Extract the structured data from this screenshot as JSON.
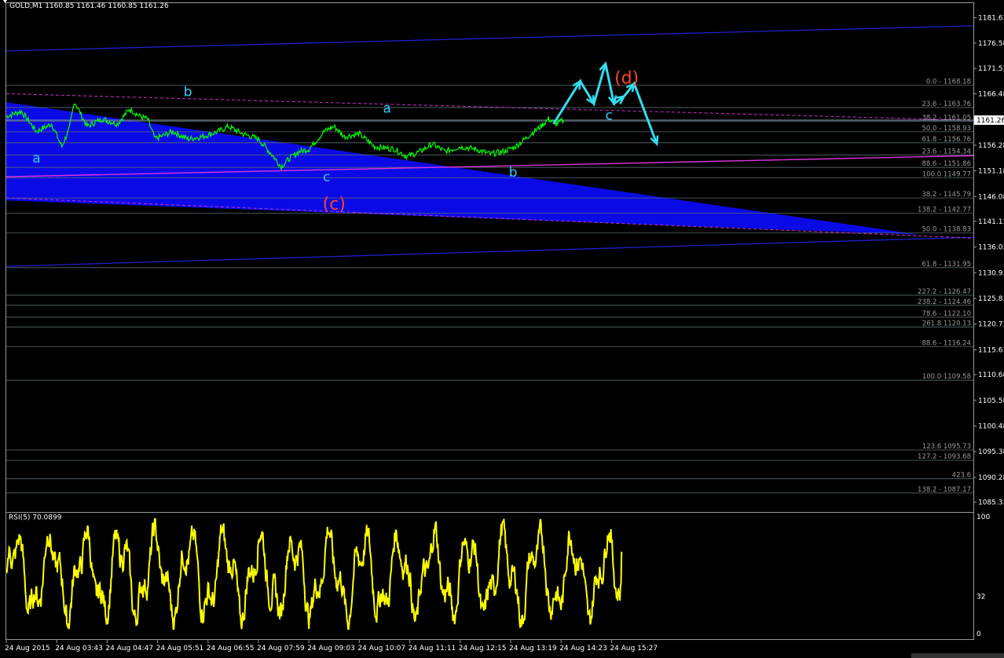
{
  "title": "GOLD,M1  1160.85 1161.46 1160.85 1161.26",
  "colors": {
    "background": "#000000",
    "price_line": "#00ff00",
    "triangle_fill": "#0a0ae6",
    "channel": "#2020d0",
    "dashed_magenta": "#cc33cc",
    "wave_label": "#33ccff",
    "wave_label_big": "#ff4422",
    "rsi_line": "#ffff00",
    "current_price_bg": "#ffffff"
  },
  "chart_data": {
    "type": "line",
    "symbol": "GOLD",
    "timeframe": "M1",
    "ohlc_header": {
      "open": 1160.85,
      "high": 1161.46,
      "low": 1160.85,
      "close": 1161.26
    },
    "current_price": 1161.26,
    "ylim": [
      1083.4,
      1184.5
    ],
    "y_ticks": [
      "1181.63",
      "1176.58",
      "1171.53",
      "1166.48",
      "1161.26",
      "1156.28",
      "1151.18",
      "1146.08",
      "1141.13",
      "1136.03",
      "1130.93",
      "1125.83",
      "1120.73",
      "1115.63",
      "1110.68",
      "1105.58",
      "1100.48",
      "1095.38",
      "1090.28",
      "1085.33"
    ],
    "x_ticks": [
      "24 Aug 2015",
      "24 Aug 03:43",
      "24 Aug 04:47",
      "24 Aug 05:51",
      "24 Aug 06:55",
      "24 Aug 07:59",
      "24 Aug 09:03",
      "24 Aug 10:07",
      "24 Aug 11:11",
      "24 Aug 12:15",
      "24 Aug 13:19",
      "24 Aug 14:23",
      "24 Aug 15:27"
    ],
    "price_anchors": [
      [
        0,
        1162.0
      ],
      [
        0.3,
        1163.0
      ],
      [
        0.6,
        1159.0
      ],
      [
        0.9,
        1160.5
      ],
      [
        1.1,
        1156.0
      ],
      [
        1.25,
        1159.5
      ],
      [
        1.35,
        1165.0
      ],
      [
        1.6,
        1160.0
      ],
      [
        1.9,
        1161.5
      ],
      [
        2.2,
        1160.5
      ],
      [
        2.45,
        1163.5
      ],
      [
        2.65,
        1162.0
      ],
      [
        2.8,
        1161.5
      ],
      [
        2.95,
        1157.5
      ],
      [
        3.3,
        1159.0
      ],
      [
        3.6,
        1157.5
      ],
      [
        3.9,
        1158.0
      ],
      [
        4.2,
        1159.0
      ],
      [
        4.4,
        1160.0
      ],
      [
        4.7,
        1158.5
      ],
      [
        5.0,
        1157.5
      ],
      [
        5.3,
        1154.0
      ],
      [
        5.45,
        1152.0
      ],
      [
        5.6,
        1153.5
      ],
      [
        5.8,
        1155.0
      ],
      [
        6.0,
        1155.5
      ],
      [
        6.3,
        1159.0
      ],
      [
        6.5,
        1160.0
      ],
      [
        6.7,
        1158.0
      ],
      [
        7.0,
        1158.5
      ],
      [
        7.3,
        1156.0
      ],
      [
        7.7,
        1155.5
      ],
      [
        7.95,
        1154.0
      ],
      [
        8.2,
        1155.0
      ],
      [
        8.45,
        1156.5
      ],
      [
        8.7,
        1155.0
      ],
      [
        9.0,
        1156.0
      ],
      [
        9.3,
        1155.5
      ],
      [
        9.6,
        1154.5
      ],
      [
        9.85,
        1155.0
      ],
      [
        10.1,
        1156.0
      ],
      [
        10.4,
        1158.5
      ],
      [
        10.6,
        1160.0
      ],
      [
        10.75,
        1161.5
      ],
      [
        10.9,
        1160.5
      ],
      [
        11.05,
        1161.2
      ]
    ],
    "fib_levels": [
      {
        "label": "0.0 - 1168.18",
        "price": 1168.18
      },
      {
        "label": "23.6 - 1163.76",
        "price": 1163.76
      },
      {
        "label": "38.2 - 1161.05",
        "price": 1161.05
      },
      {
        "label": "50.0 - 1158.93",
        "price": 1158.93
      },
      {
        "label": "61.8 - 1156.76",
        "price": 1156.76
      },
      {
        "label": "23.6 - 1154.34",
        "price": 1154.34
      },
      {
        "label": "88.6 - 1151.86",
        "price": 1151.86
      },
      {
        "label": "100.0 1149.77",
        "price": 1149.77
      },
      {
        "label": "38.2 - 1145.79",
        "price": 1145.79
      },
      {
        "label": "138.2 - 1142.77",
        "price": 1142.77
      },
      {
        "label": "50.0 - 1138.83",
        "price": 1138.83
      },
      {
        "label": "61.8 - 1131.95",
        "price": 1131.95
      },
      {
        "label": "227.2 - 1126.47",
        "price": 1126.47
      },
      {
        "label": "238.2 - 1124.46",
        "price": 1124.46
      },
      {
        "label": "78.6 - 1122.10",
        "price": 1122.1
      },
      {
        "label": "261.8 1120.13",
        "price": 1120.13
      },
      {
        "label": "88.6 - 1116.24",
        "price": 1116.24
      },
      {
        "label": "100.0 1109.58",
        "price": 1109.58
      },
      {
        "label": "123.6 1095.73",
        "price": 1095.73
      },
      {
        "label": "127.2 - 1093.68",
        "price": 1093.68
      },
      {
        "label": "423.6",
        "price": 1090.0
      },
      {
        "label": "138.2 - 1087.17",
        "price": 1087.17
      }
    ],
    "wave_labels": [
      {
        "text": "a",
        "x": 0.6,
        "price": 1152.8,
        "style": "blue"
      },
      {
        "text": "b",
        "x": 3.6,
        "price": 1166.0,
        "style": "blue"
      },
      {
        "text": "c",
        "x": 6.35,
        "price": 1149.1,
        "style": "blue"
      },
      {
        "text": "(c)",
        "x": 6.5,
        "price": 1143.5,
        "style": "red"
      },
      {
        "text": "a",
        "x": 7.55,
        "price": 1162.7,
        "style": "blue"
      },
      {
        "text": "b",
        "x": 10.05,
        "price": 1150.0,
        "style": "blue"
      },
      {
        "text": "c",
        "x": 11.95,
        "price": 1161.3,
        "style": "blue"
      },
      {
        "text": "(d)",
        "x": 12.3,
        "price": 1168.5,
        "style": "red"
      }
    ],
    "projection_path": [
      [
        10.85,
        1160.5
      ],
      [
        11.38,
        1169.0
      ],
      [
        11.65,
        1164.5
      ],
      [
        11.88,
        1172.5
      ],
      [
        12.05,
        1164.5
      ],
      [
        12.25,
        1166.0
      ],
      [
        12.45,
        1168.5
      ],
      [
        12.9,
        1156.5
      ]
    ],
    "rsi": {
      "label": "RSI(5) 70.0899",
      "period": 5,
      "last_value": 70.0899,
      "ylim": [
        0,
        100
      ],
      "y_ticks": [
        "100",
        "32",
        "0"
      ]
    }
  }
}
